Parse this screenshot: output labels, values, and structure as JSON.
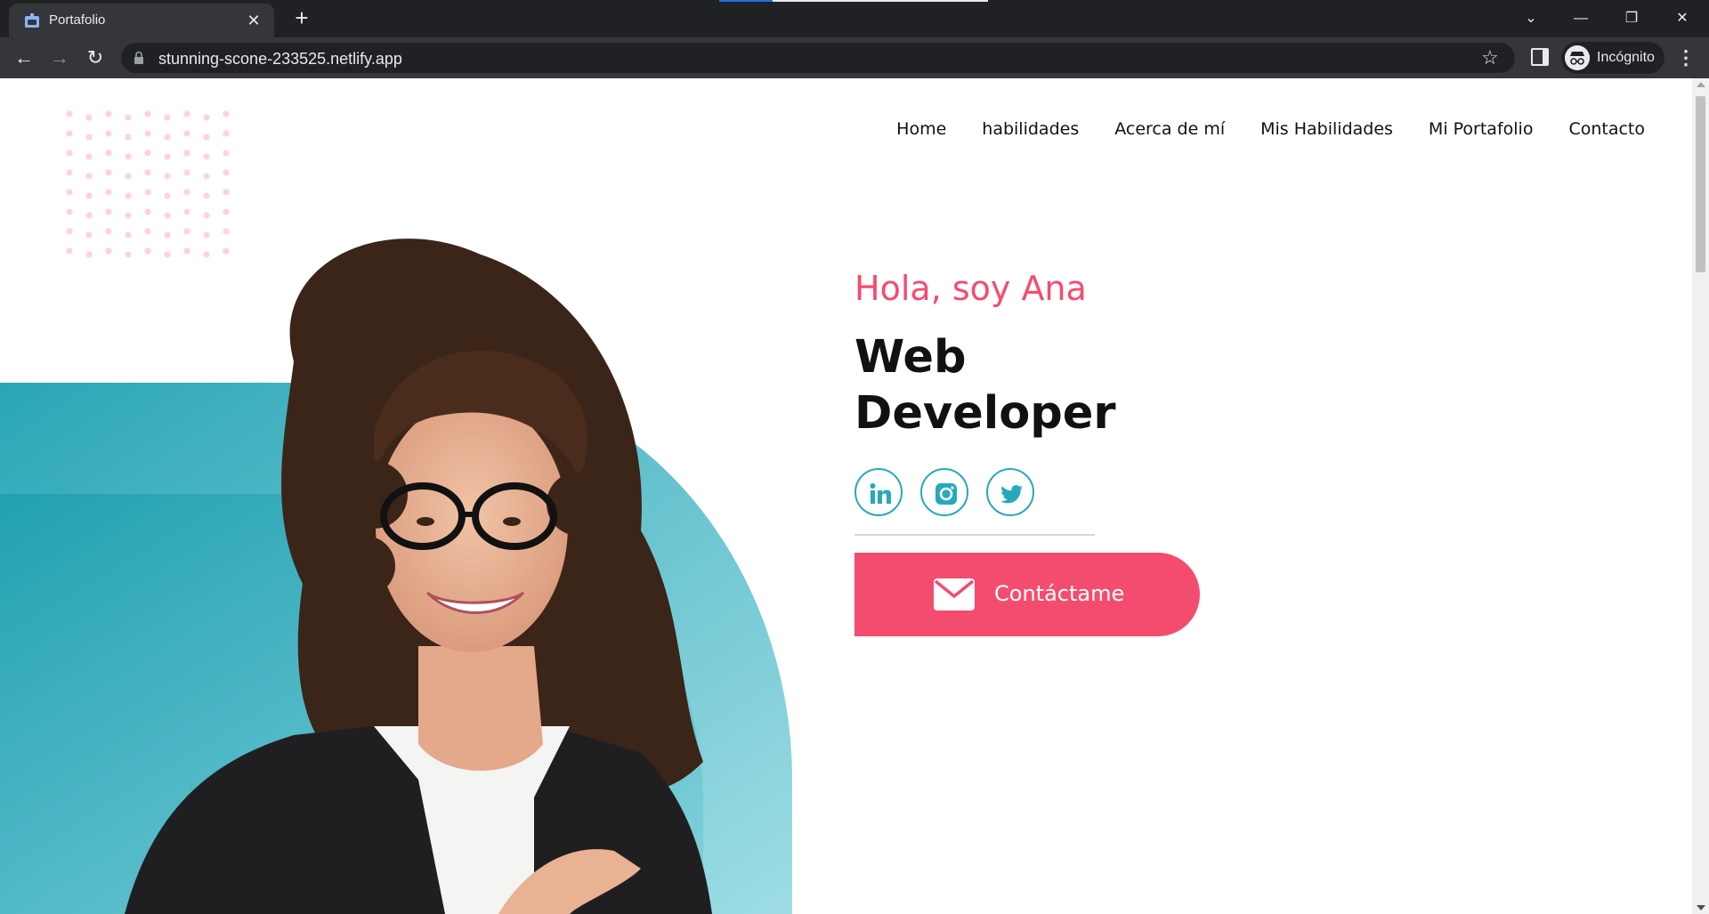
{
  "browser": {
    "tab_title": "Portafolio",
    "url": "stunning-scone-233525.netlify.app",
    "incognito_label": "Incógnito"
  },
  "site": {
    "nav": [
      "Home",
      "habilidades",
      "Acerca de mí",
      "Mis Habilidades",
      "Mi Portafolio",
      "Contacto"
    ],
    "greeting": "Hola, soy Ana",
    "role_line1": "Web",
    "role_line2": "Developer",
    "socials": [
      "linkedin-icon",
      "instagram-icon",
      "twitter-icon"
    ],
    "cta_label": "Contáctame"
  },
  "colors": {
    "accent": "#f44c6e",
    "teal": "#27a9b9",
    "chrome_dark": "#202124",
    "chrome_toolbar": "#35363a"
  }
}
